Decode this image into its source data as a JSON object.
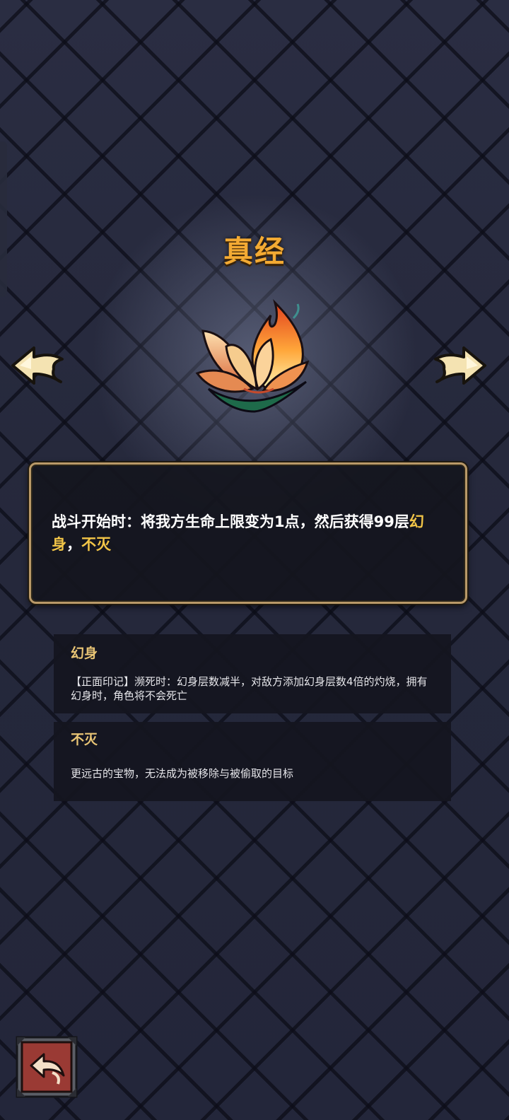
{
  "relic": {
    "title": "真经",
    "art_icon": "flaming-lotus-icon"
  },
  "navigation": {
    "prev_icon": "left-arrow-icon",
    "next_icon": "right-arrow-icon",
    "back_icon": "return-arrow-icon"
  },
  "description": {
    "prefix": "战斗开始时：将我方生命上限变为1点，然后获得99层",
    "keyword1": "幻身",
    "separator": "，",
    "keyword2": "不灭"
  },
  "keywords": [
    {
      "title": "幻身",
      "description": "【正面印记】濒死时：幻身层数减半，对敌方添加幻身层数4倍的灼烧，拥有幻身时，角色将不会死亡"
    },
    {
      "title": "不灭",
      "description": "更远古的宝物，无法成为被移除与被偷取的目标"
    }
  ],
  "colors": {
    "title": "#f3aa33",
    "keyword_highlight": "#f2c547",
    "panel_border": "#b99968",
    "background": "#272a3e"
  }
}
